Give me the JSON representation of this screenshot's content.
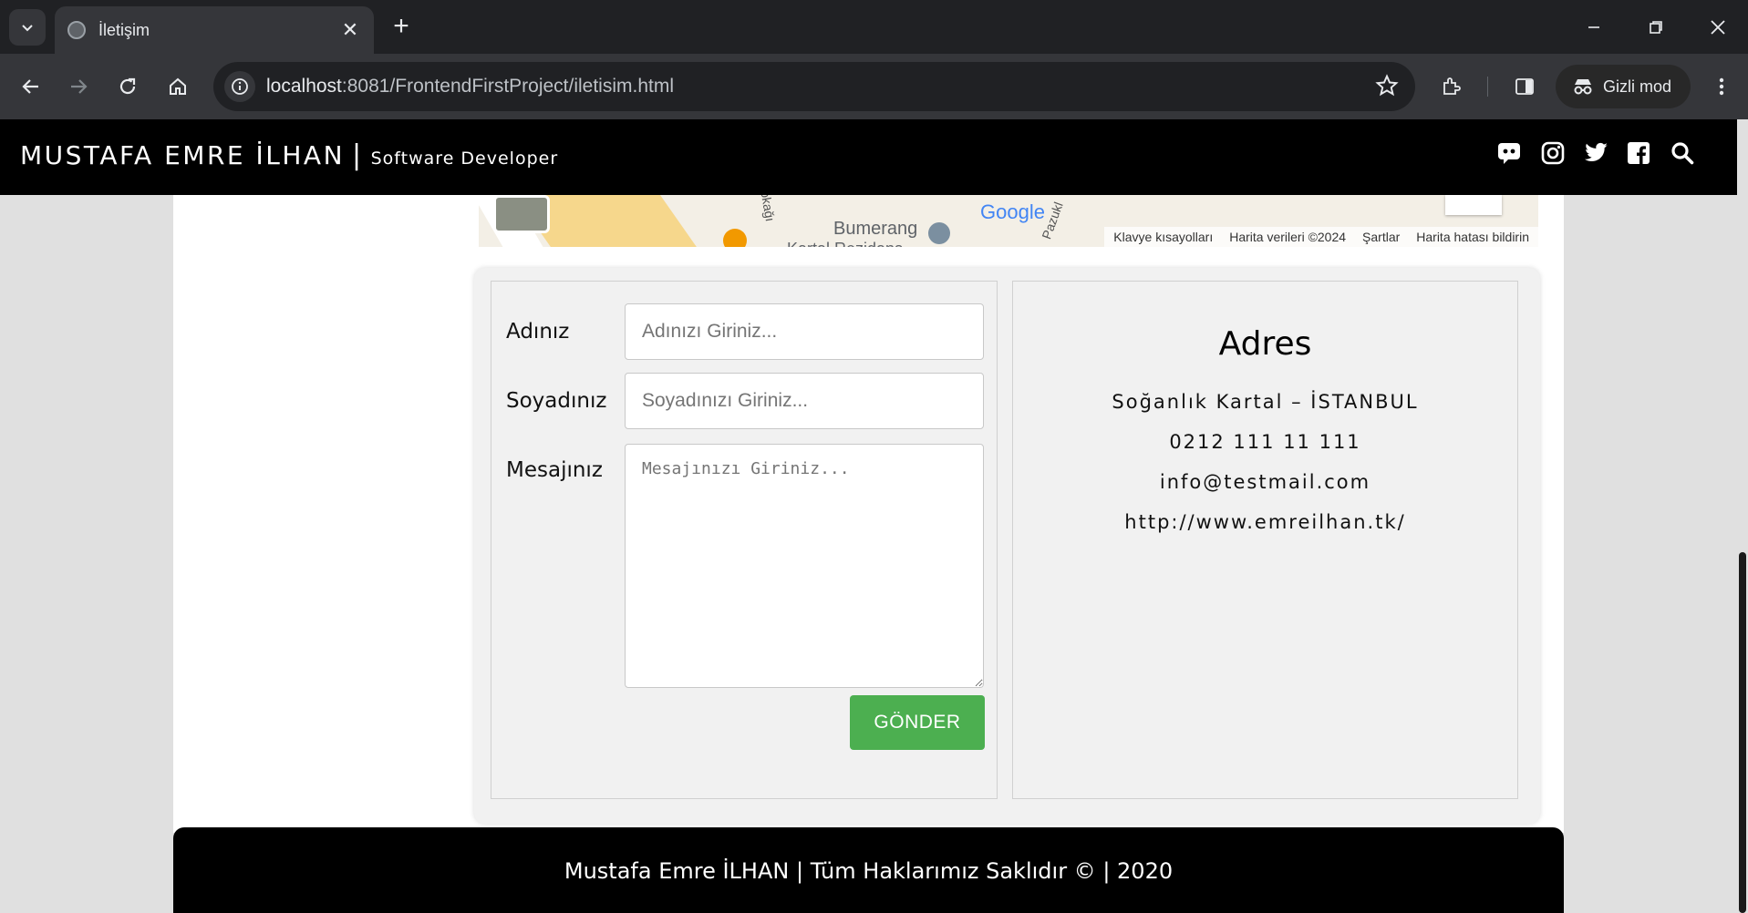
{
  "browser": {
    "tab_title": "İletişim",
    "url_host": "localhost",
    "url_rest": ":8081/FrontendFirstProject/iletisim.html",
    "incognito_label": "Gizli mod"
  },
  "header": {
    "brand": "MUSTAFA EMRE İLHAN",
    "separator": "|",
    "subtitle": "Software Developer",
    "social_icons": [
      "discord-icon",
      "instagram-icon",
      "twitter-icon",
      "facebook-icon",
      "search-icon"
    ]
  },
  "map": {
    "labels": {
      "street1": "okağı",
      "street2": "Pazukl",
      "place": "Bumerang",
      "place2": "Kartal Rezidans",
      "brand": "Google"
    },
    "footer": {
      "shortcuts": "Klavye kısayolları",
      "map_data": "Harita verileri ©2024",
      "terms": "Şartlar",
      "report": "Harita hatası bildirin"
    }
  },
  "form": {
    "name_label": "Adınız",
    "name_placeholder": "Adınızı Giriniz...",
    "surname_label": "Soyadınız",
    "surname_placeholder": "Soyadınızı Giriniz...",
    "message_label": "Mesajınız",
    "message_placeholder": "Mesajınızı Giriniz...",
    "submit_label": "GÖNDER",
    "submit_color": "#4caf50"
  },
  "address": {
    "title": "Adres",
    "location": "Soğanlık Kartal – İSTANBUL",
    "phone": "0212 111 11 111",
    "email": "info@testmail.com",
    "website": "http://www.emreilhan.tk/"
  },
  "footer": {
    "text": "Mustafa Emre İLHAN | Tüm Haklarımız Saklıdır © | 2020"
  }
}
